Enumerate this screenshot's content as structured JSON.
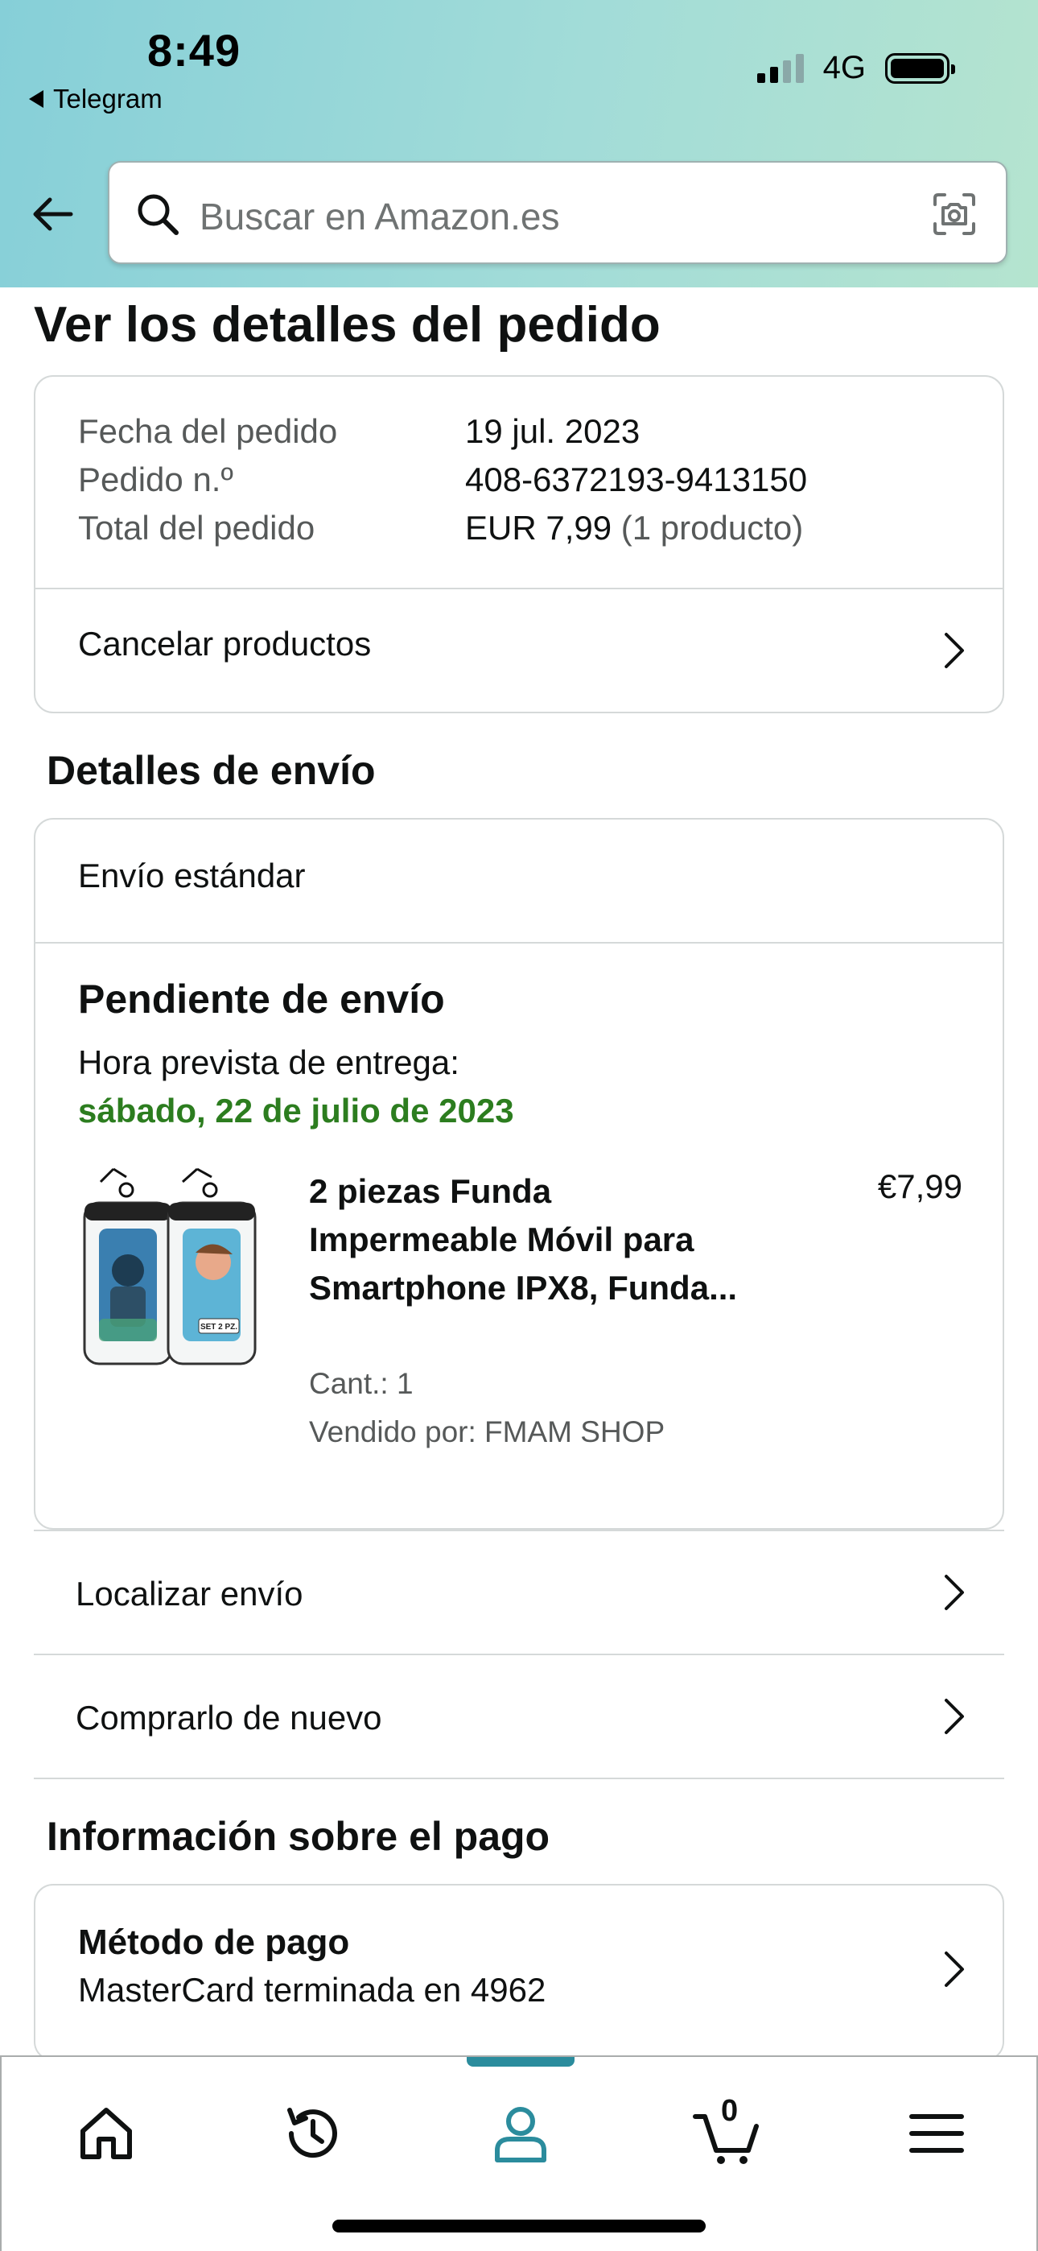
{
  "status_bar": {
    "time": "8:49",
    "back_app": "Telegram",
    "network": "4G"
  },
  "search": {
    "placeholder": "Buscar en Amazon.es"
  },
  "page": {
    "title": "Ver los detalles del pedido"
  },
  "order": {
    "date_label": "Fecha del pedido",
    "date_value": "19 jul. 2023",
    "number_label": "Pedido n.º",
    "number_value": "408-6372193-9413150",
    "total_label": "Total del pedido",
    "total_value": "EUR 7,99",
    "total_items": "(1 producto)",
    "cancel_label": "Cancelar productos"
  },
  "shipping": {
    "section_title": "Detalles de envío",
    "method": "Envío estándar",
    "status": "Pendiente de envío",
    "estimate_label": "Hora prevista de entrega:",
    "estimate_date": "sábado, 22 de julio de 2023",
    "product": {
      "title": "2 piezas Funda Impermeable Móvil para Smartphone IPX8, Funda...",
      "price": "€7,99",
      "quantity": "Cant.: 1",
      "seller": "Vendido por: FMAM SHOP"
    },
    "track_label": "Localizar envío",
    "buy_again_label": "Comprarlo de nuevo"
  },
  "payment": {
    "section_title": "Información sobre el pago",
    "method_title": "Método de pago",
    "method_detail": "MasterCard terminada en 4962"
  },
  "tabbar": {
    "cart_count": "0",
    "active_tab": "account",
    "accent_color": "#2b8c9d"
  },
  "colors": {
    "delivery_green": "#2c7d1f",
    "border": "#d5d9d9"
  }
}
